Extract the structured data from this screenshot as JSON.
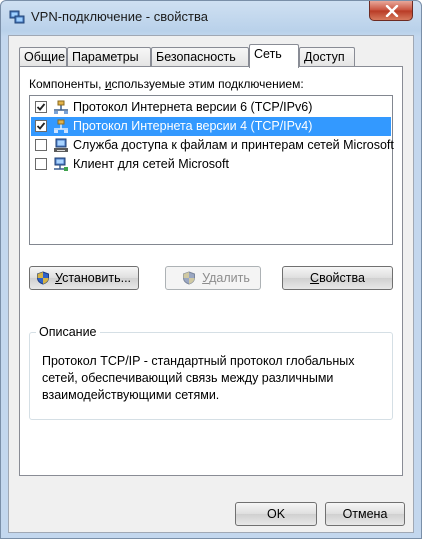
{
  "window": {
    "title": "VPN-подключение - свойства"
  },
  "tabs": [
    {
      "label": "Общие",
      "active": false
    },
    {
      "label": "Параметры",
      "active": false
    },
    {
      "label": "Безопасность",
      "active": false
    },
    {
      "label": "Сеть",
      "active": true
    },
    {
      "label": "Доступ",
      "active": false
    }
  ],
  "components": {
    "label_pre": "Компоненты, ",
    "label_u": "и",
    "label_post": "спользуемые этим подключением:",
    "items": [
      {
        "label": "Протокол Интернета версии 6 (TCP/IPv6)",
        "checked": true,
        "selected": false,
        "icon": "network-protocol-icon"
      },
      {
        "label": "Протокол Интернета версии 4 (TCP/IPv4)",
        "checked": true,
        "selected": true,
        "icon": "network-protocol-icon"
      },
      {
        "label": "Служба доступа к файлам и принтерам сетей Microsoft",
        "checked": false,
        "selected": false,
        "icon": "file-printer-sharing-icon"
      },
      {
        "label": "Клиент для сетей Microsoft",
        "checked": false,
        "selected": false,
        "icon": "network-client-icon"
      }
    ]
  },
  "actions": {
    "install_u": "У",
    "install_rest": "становить...",
    "remove_u": "У",
    "remove_rest": "далить",
    "properties_u": "С",
    "properties_rest": "войства"
  },
  "description": {
    "legend": "Описание",
    "text": "Протокол TCP/IP - стандартный протокол глобальных сетей, обеспечивающий связь между различными взаимодействующими сетями."
  },
  "footer": {
    "ok": "OK",
    "cancel": "Отмена"
  },
  "colors": {
    "selection": "#3399ff",
    "close_button": "#c7503b",
    "title_bar": "#b9d1ea"
  }
}
